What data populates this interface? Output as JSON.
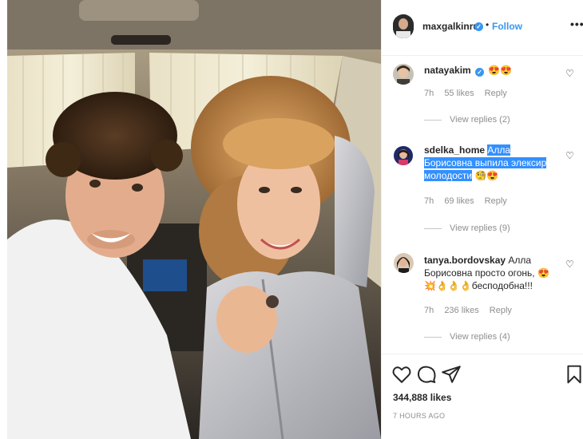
{
  "post": {
    "author": "maxgalkinru",
    "separator": "•",
    "follow_label": "Follow",
    "more_label": "•••",
    "verified_mark": "✓",
    "like_count": "344,888 likes",
    "time_ago": "7 HOURS AGO"
  },
  "comments": [
    {
      "username": "natayakim",
      "verified": true,
      "text": "😍😍",
      "time": "7h",
      "likes": "55 likes",
      "reply_label": "Reply",
      "view_replies": "View replies (2)",
      "heart_icon": "♡"
    },
    {
      "username": "sdelka_home",
      "text_highlighted": "Алла Борисовна выпила элексир молодости",
      "text_rest": "🧐😍",
      "time": "7h",
      "likes": "69 likes",
      "reply_label": "Reply",
      "view_replies": "View replies (9)",
      "heart_icon": "♡"
    },
    {
      "username": "tanya.bordovskay",
      "text": "Алла Борисовна просто огонь, 😍💥👌👌👌бесподобна!!!",
      "time": "7h",
      "likes": "236 likes",
      "reply_label": "Reply",
      "view_replies": "View replies (4)",
      "heart_icon": "♡"
    }
  ],
  "icons": {
    "like": "heart-icon",
    "comment": "comment-icon",
    "share": "share-icon",
    "save": "bookmark-icon"
  },
  "colors": {
    "accent": "#3897f0",
    "highlight": "#3390ff",
    "muted": "#8e8e8e"
  }
}
